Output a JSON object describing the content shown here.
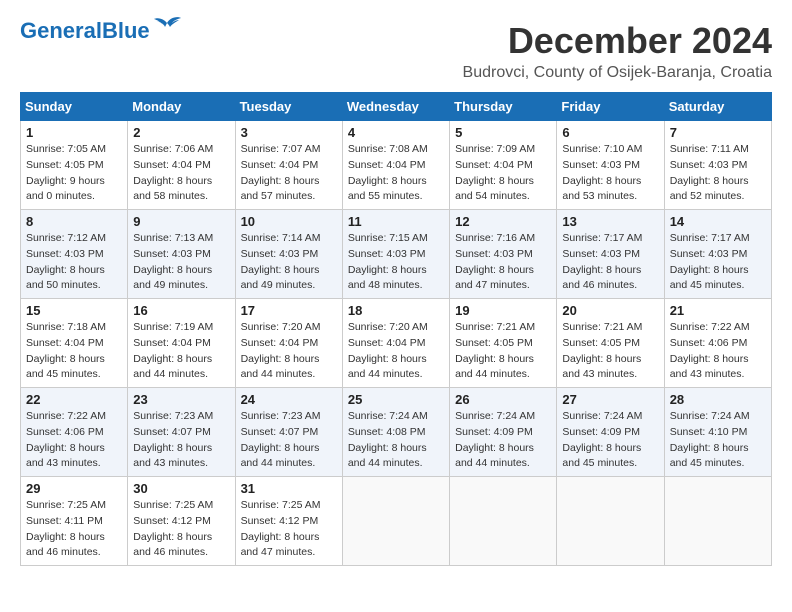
{
  "header": {
    "logo_general": "General",
    "logo_blue": "Blue",
    "month_year": "December 2024",
    "location": "Budrovci, County of Osijek-Baranja, Croatia"
  },
  "calendar": {
    "columns": [
      "Sunday",
      "Monday",
      "Tuesday",
      "Wednesday",
      "Thursday",
      "Friday",
      "Saturday"
    ],
    "weeks": [
      [
        {
          "day": "1",
          "sunrise": "7:05 AM",
          "sunset": "4:05 PM",
          "daylight": "9 hours and 0 minutes."
        },
        {
          "day": "2",
          "sunrise": "7:06 AM",
          "sunset": "4:04 PM",
          "daylight": "8 hours and 58 minutes."
        },
        {
          "day": "3",
          "sunrise": "7:07 AM",
          "sunset": "4:04 PM",
          "daylight": "8 hours and 57 minutes."
        },
        {
          "day": "4",
          "sunrise": "7:08 AM",
          "sunset": "4:04 PM",
          "daylight": "8 hours and 55 minutes."
        },
        {
          "day": "5",
          "sunrise": "7:09 AM",
          "sunset": "4:04 PM",
          "daylight": "8 hours and 54 minutes."
        },
        {
          "day": "6",
          "sunrise": "7:10 AM",
          "sunset": "4:03 PM",
          "daylight": "8 hours and 53 minutes."
        },
        {
          "day": "7",
          "sunrise": "7:11 AM",
          "sunset": "4:03 PM",
          "daylight": "8 hours and 52 minutes."
        }
      ],
      [
        {
          "day": "8",
          "sunrise": "7:12 AM",
          "sunset": "4:03 PM",
          "daylight": "8 hours and 50 minutes."
        },
        {
          "day": "9",
          "sunrise": "7:13 AM",
          "sunset": "4:03 PM",
          "daylight": "8 hours and 49 minutes."
        },
        {
          "day": "10",
          "sunrise": "7:14 AM",
          "sunset": "4:03 PM",
          "daylight": "8 hours and 49 minutes."
        },
        {
          "day": "11",
          "sunrise": "7:15 AM",
          "sunset": "4:03 PM",
          "daylight": "8 hours and 48 minutes."
        },
        {
          "day": "12",
          "sunrise": "7:16 AM",
          "sunset": "4:03 PM",
          "daylight": "8 hours and 47 minutes."
        },
        {
          "day": "13",
          "sunrise": "7:17 AM",
          "sunset": "4:03 PM",
          "daylight": "8 hours and 46 minutes."
        },
        {
          "day": "14",
          "sunrise": "7:17 AM",
          "sunset": "4:03 PM",
          "daylight": "8 hours and 45 minutes."
        }
      ],
      [
        {
          "day": "15",
          "sunrise": "7:18 AM",
          "sunset": "4:04 PM",
          "daylight": "8 hours and 45 minutes."
        },
        {
          "day": "16",
          "sunrise": "7:19 AM",
          "sunset": "4:04 PM",
          "daylight": "8 hours and 44 minutes."
        },
        {
          "day": "17",
          "sunrise": "7:20 AM",
          "sunset": "4:04 PM",
          "daylight": "8 hours and 44 minutes."
        },
        {
          "day": "18",
          "sunrise": "7:20 AM",
          "sunset": "4:04 PM",
          "daylight": "8 hours and 44 minutes."
        },
        {
          "day": "19",
          "sunrise": "7:21 AM",
          "sunset": "4:05 PM",
          "daylight": "8 hours and 44 minutes."
        },
        {
          "day": "20",
          "sunrise": "7:21 AM",
          "sunset": "4:05 PM",
          "daylight": "8 hours and 43 minutes."
        },
        {
          "day": "21",
          "sunrise": "7:22 AM",
          "sunset": "4:06 PM",
          "daylight": "8 hours and 43 minutes."
        }
      ],
      [
        {
          "day": "22",
          "sunrise": "7:22 AM",
          "sunset": "4:06 PM",
          "daylight": "8 hours and 43 minutes."
        },
        {
          "day": "23",
          "sunrise": "7:23 AM",
          "sunset": "4:07 PM",
          "daylight": "8 hours and 43 minutes."
        },
        {
          "day": "24",
          "sunrise": "7:23 AM",
          "sunset": "4:07 PM",
          "daylight": "8 hours and 44 minutes."
        },
        {
          "day": "25",
          "sunrise": "7:24 AM",
          "sunset": "4:08 PM",
          "daylight": "8 hours and 44 minutes."
        },
        {
          "day": "26",
          "sunrise": "7:24 AM",
          "sunset": "4:09 PM",
          "daylight": "8 hours and 44 minutes."
        },
        {
          "day": "27",
          "sunrise": "7:24 AM",
          "sunset": "4:09 PM",
          "daylight": "8 hours and 45 minutes."
        },
        {
          "day": "28",
          "sunrise": "7:24 AM",
          "sunset": "4:10 PM",
          "daylight": "8 hours and 45 minutes."
        }
      ],
      [
        {
          "day": "29",
          "sunrise": "7:25 AM",
          "sunset": "4:11 PM",
          "daylight": "8 hours and 46 minutes."
        },
        {
          "day": "30",
          "sunrise": "7:25 AM",
          "sunset": "4:12 PM",
          "daylight": "8 hours and 46 minutes."
        },
        {
          "day": "31",
          "sunrise": "7:25 AM",
          "sunset": "4:12 PM",
          "daylight": "8 hours and 47 minutes."
        },
        null,
        null,
        null,
        null
      ]
    ]
  }
}
